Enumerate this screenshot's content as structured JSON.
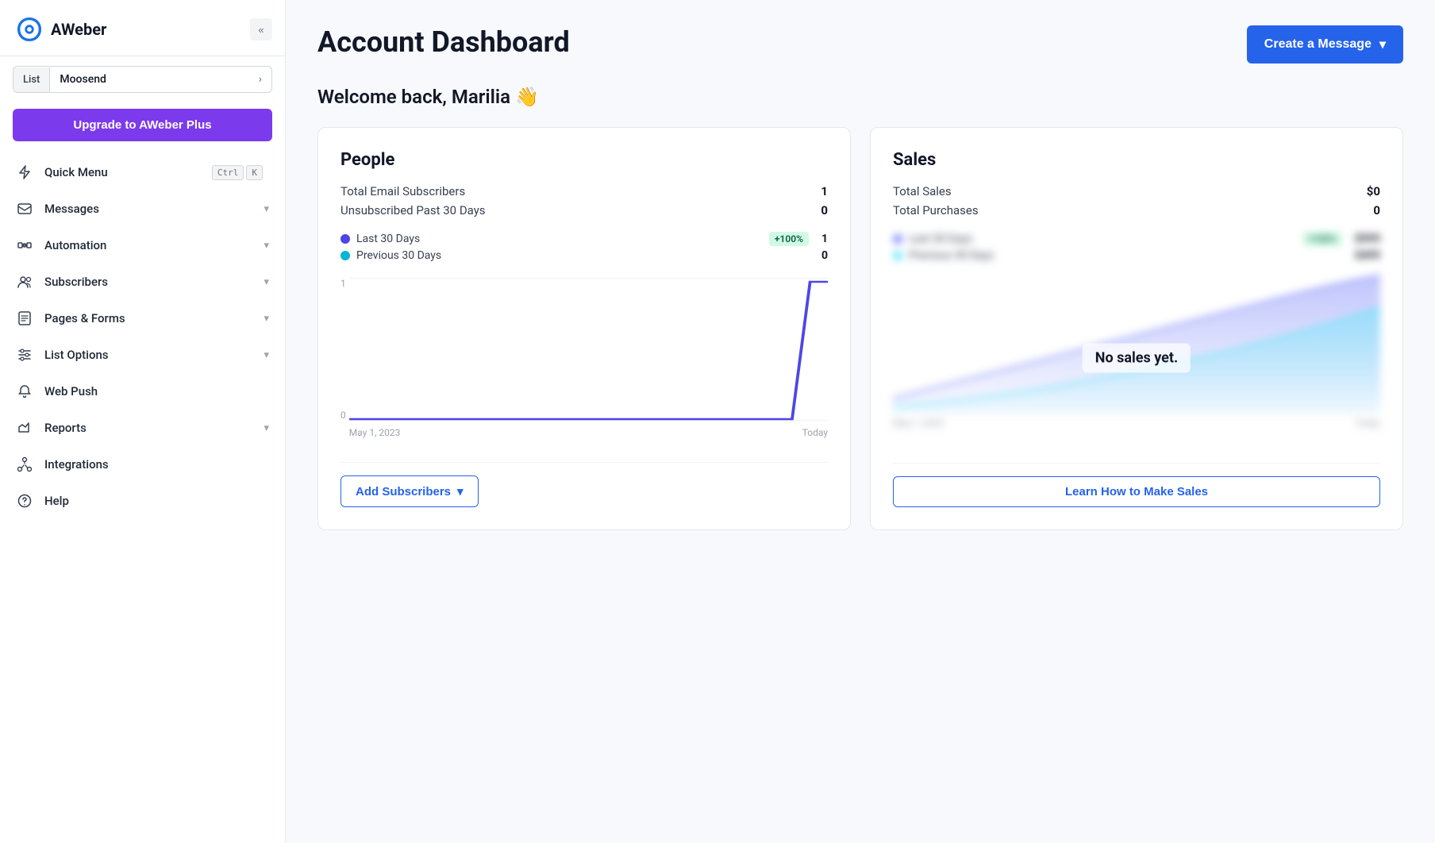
{
  "sidebar": {
    "logo_text": "AWeber",
    "collapse_icon": "«",
    "list_label": "List",
    "list_name": "Moosend",
    "list_chevron": "›",
    "upgrade_btn": "Upgrade to AWeber Plus",
    "nav_items": [
      {
        "id": "quick-menu",
        "label": "Quick Menu",
        "icon": "lightning",
        "shortcut": [
          "Ctrl",
          "K"
        ],
        "has_chevron": false
      },
      {
        "id": "messages",
        "label": "Messages",
        "icon": "envelope",
        "has_chevron": true
      },
      {
        "id": "automation",
        "label": "Automation",
        "icon": "automation",
        "has_chevron": true
      },
      {
        "id": "subscribers",
        "label": "Subscribers",
        "icon": "people",
        "has_chevron": true
      },
      {
        "id": "pages-forms",
        "label": "Pages & Forms",
        "icon": "pages",
        "has_chevron": true
      },
      {
        "id": "list-options",
        "label": "List Options",
        "icon": "sliders",
        "has_chevron": true
      },
      {
        "id": "web-push",
        "label": "Web Push",
        "icon": "bell",
        "has_chevron": false
      },
      {
        "id": "reports",
        "label": "Reports",
        "icon": "chart",
        "has_chevron": true
      },
      {
        "id": "integrations",
        "label": "Integrations",
        "icon": "integrations",
        "has_chevron": false
      },
      {
        "id": "help",
        "label": "Help",
        "icon": "question",
        "has_chevron": false
      }
    ]
  },
  "header": {
    "title": "Account Dashboard",
    "create_btn": "Create a Message",
    "create_chevron": "▾"
  },
  "welcome": {
    "text": "Welcome back, Marilia",
    "emoji": "👋"
  },
  "people_card": {
    "title": "People",
    "stats": [
      {
        "label": "Total Email Subscribers",
        "value": "1"
      },
      {
        "label": "Unsubscribed Past 30 Days",
        "value": "0"
      }
    ],
    "legend": [
      {
        "label": "Last 30 Days",
        "color": "#4f46e5",
        "badge": "+100%",
        "value": "1"
      },
      {
        "label": "Previous 30 Days",
        "color": "#06b6d4",
        "badge": null,
        "value": "0"
      }
    ],
    "chart_y_labels": [
      "1",
      "0"
    ],
    "chart_dates": [
      "May 1, 2023",
      "Today"
    ],
    "add_btn": "Add Subscribers",
    "add_chevron": "▾"
  },
  "sales_card": {
    "title": "Sales",
    "stats": [
      {
        "label": "Total Sales",
        "value": "$0"
      },
      {
        "label": "Total Purchases",
        "value": "0"
      }
    ],
    "legend": [
      {
        "label": "Last 30 Days",
        "color": "#818cf8",
        "badge": "blurred",
        "value": "blurred"
      },
      {
        "label": "Previous 30 Days",
        "color": "#67e8f9",
        "badge": null,
        "value": "blurred"
      }
    ],
    "no_sales_text": "No sales yet.",
    "learn_btn": "Learn How to Make Sales",
    "chart_dates": [
      "May 1, 2023",
      "Today"
    ]
  }
}
